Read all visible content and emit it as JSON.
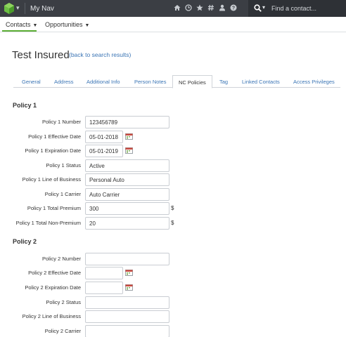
{
  "topbar": {
    "nav_title": "My Nav",
    "icons": [
      "home-icon",
      "clock-icon",
      "star-icon",
      "hashtag-icon",
      "user-icon",
      "help-icon"
    ],
    "search_placeholder": "Find a contact..."
  },
  "subnav": {
    "contacts": "Contacts",
    "opportunities": "Opportunities"
  },
  "page": {
    "title": "Test Insured",
    "back_link": "(back to search results)"
  },
  "tabs": [
    {
      "label": "General",
      "active": false
    },
    {
      "label": "Address",
      "active": false
    },
    {
      "label": "Additional Info",
      "active": false
    },
    {
      "label": "Person Notes",
      "active": false
    },
    {
      "label": "NC Policies",
      "active": true
    },
    {
      "label": "Tag",
      "active": false
    },
    {
      "label": "Linked Contacts",
      "active": false
    },
    {
      "label": "Access Privileges",
      "active": false
    }
  ],
  "policy1": {
    "header": "Policy 1",
    "number_label": "Policy 1 Number",
    "number_value": "123456789",
    "effective_label": "Policy 1 Effective Date",
    "effective_value": "05-01-2018",
    "expiration_label": "Policy 1 Expiration Date",
    "expiration_value": "05-01-2019",
    "status_label": "Policy 1 Status",
    "status_value": "Active",
    "lob_label": "Policy 1 Line of Business",
    "lob_value": "Personal Auto",
    "carrier_label": "Policy 1 Carrier",
    "carrier_value": "Auto Carrier",
    "premium_label": "Policy 1 Total Premium",
    "premium_value": "300",
    "nonpremium_label": "Policy 1 Total Non-Premium",
    "nonpremium_value": "20",
    "currency": "$"
  },
  "policy2": {
    "header": "Policy 2",
    "number_label": "Policy 2 Number",
    "number_value": "",
    "effective_label": "Policy 2 Effective Date",
    "effective_value": "",
    "expiration_label": "Policy 2 Expiration Date",
    "expiration_value": "",
    "status_label": "Policy 2 Status",
    "status_value": "",
    "lob_label": "Policy 2 Line of Business",
    "lob_value": "",
    "carrier_label": "Policy 2 Carrier",
    "carrier_value": ""
  },
  "colors": {
    "topbar": "#3b3e44",
    "accent_green": "#5cae35",
    "link_blue": "#3b75b5"
  }
}
